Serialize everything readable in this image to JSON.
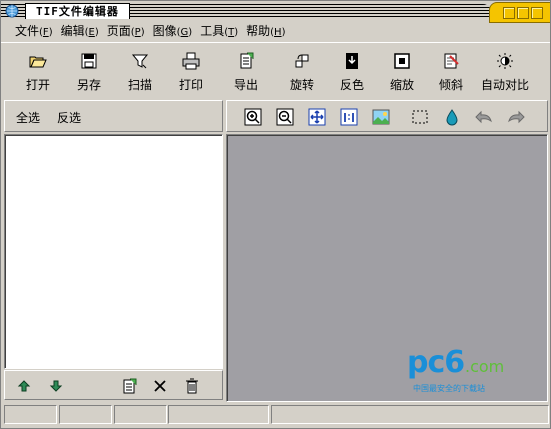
{
  "window": {
    "title_latin": "TIF",
    "title_cjk": "文件编辑器"
  },
  "menu": [
    {
      "label": "文件",
      "key": "F"
    },
    {
      "label": "编辑",
      "key": "E"
    },
    {
      "label": "页面",
      "key": "P"
    },
    {
      "label": "图像",
      "key": "G"
    },
    {
      "label": "工具",
      "key": "T"
    },
    {
      "label": "帮助",
      "key": "H"
    }
  ],
  "toolbar": [
    {
      "label": "打开",
      "icon": "open-folder-icon"
    },
    {
      "label": "另存",
      "icon": "save-disk-icon"
    },
    {
      "label": "扫描",
      "icon": "scan-funnel-icon"
    },
    {
      "label": "打印",
      "icon": "printer-icon"
    },
    {
      "label": "导出",
      "icon": "export-doc-icon"
    },
    {
      "label": "旋转",
      "icon": "rotate-icon"
    },
    {
      "label": "反色",
      "icon": "invert-color-icon"
    },
    {
      "label": "缩放",
      "icon": "scale-icon"
    },
    {
      "label": "倾斜",
      "icon": "skew-icon"
    },
    {
      "label": "自动对比",
      "icon": "auto-contrast-icon"
    }
  ],
  "selection": {
    "select_all": "全选",
    "invert_select": "反选"
  },
  "view_tools": [
    "zoom-in-icon",
    "zoom-out-icon",
    "fit-window-icon",
    "actual-size-icon",
    "image-icon",
    "marquee-select-icon",
    "drop-icon",
    "undo-icon",
    "redo-icon"
  ],
  "list_tools": [
    "move-up-icon",
    "move-down-icon",
    "add-page-icon",
    "delete-x-icon",
    "trash-icon"
  ],
  "watermark": {
    "brand_main": "pc6",
    "brand_domain": ".com",
    "tagline": "中国最安全的下载站"
  },
  "colors": {
    "chrome": "#d4d0c8",
    "canvas": "#a09fa4",
    "title_accent": "#f5c400",
    "watermark_blue": "#1a8fd8",
    "watermark_green": "#5fbf3a"
  }
}
